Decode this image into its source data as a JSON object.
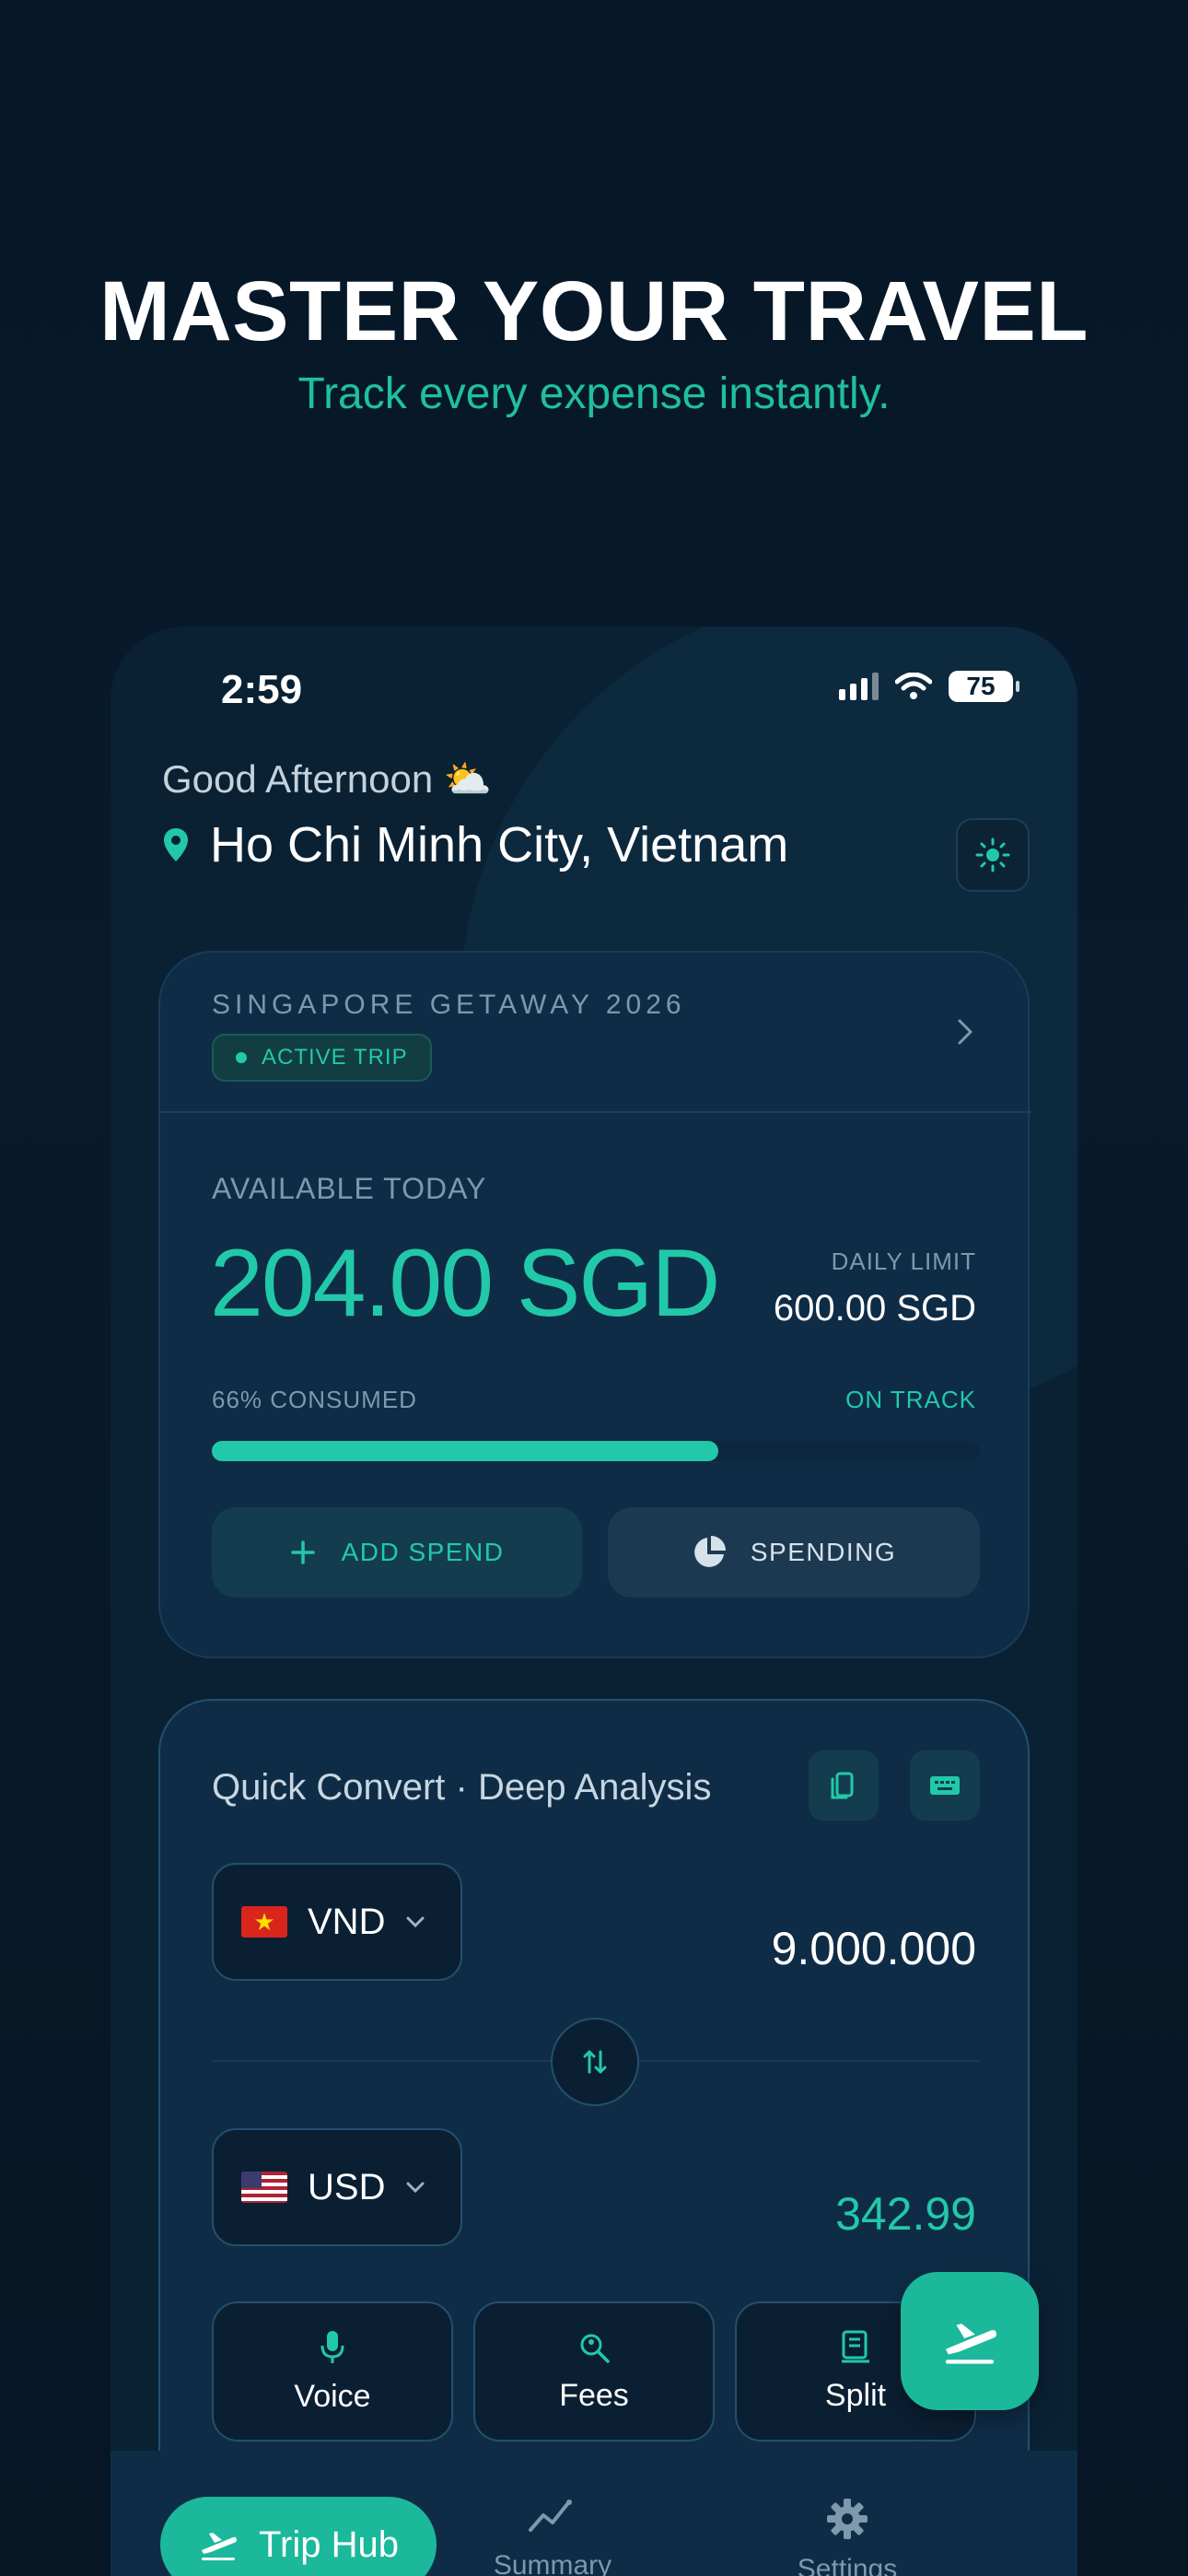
{
  "promo": {
    "headline": "MASTER YOUR TRAVEL",
    "subline": "Track every expense instantly."
  },
  "status_bar": {
    "time": "2:59",
    "battery": "75"
  },
  "header": {
    "greeting": "Good Afternoon ⛅",
    "location": "Ho Chi Minh City, Vietnam"
  },
  "trip_card": {
    "trip_name": "SINGAPORE GETAWAY 2026",
    "status_badge": "ACTIVE TRIP",
    "available_label": "AVAILABLE TODAY",
    "available_amount": "204.00 SGD",
    "daily_limit_label": "DAILY LIMIT",
    "daily_limit_value": "600.00 SGD",
    "consumed_label": "66% CONSUMED",
    "consumed_fraction": 0.66,
    "track_status": "ON TRACK",
    "add_spend_label": "ADD SPEND",
    "spending_label": "SPENDING"
  },
  "convert": {
    "title": "Quick Convert · Deep Analysis",
    "from_currency": "VND",
    "from_amount": "9.000.000",
    "to_currency": "USD",
    "to_amount": "342.99",
    "tools": [
      {
        "label": "Voice",
        "icon": "microphone-icon"
      },
      {
        "label": "Fees",
        "icon": "search-person-icon"
      },
      {
        "label": "Split",
        "icon": "receipt-icon"
      }
    ]
  },
  "tabbar": {
    "trip_hub": "Trip Hub",
    "summary": "Summary",
    "settings": "Settings"
  },
  "colors": {
    "background": "#061727",
    "accent": "#22c9a8",
    "card": "#0f2c47"
  }
}
